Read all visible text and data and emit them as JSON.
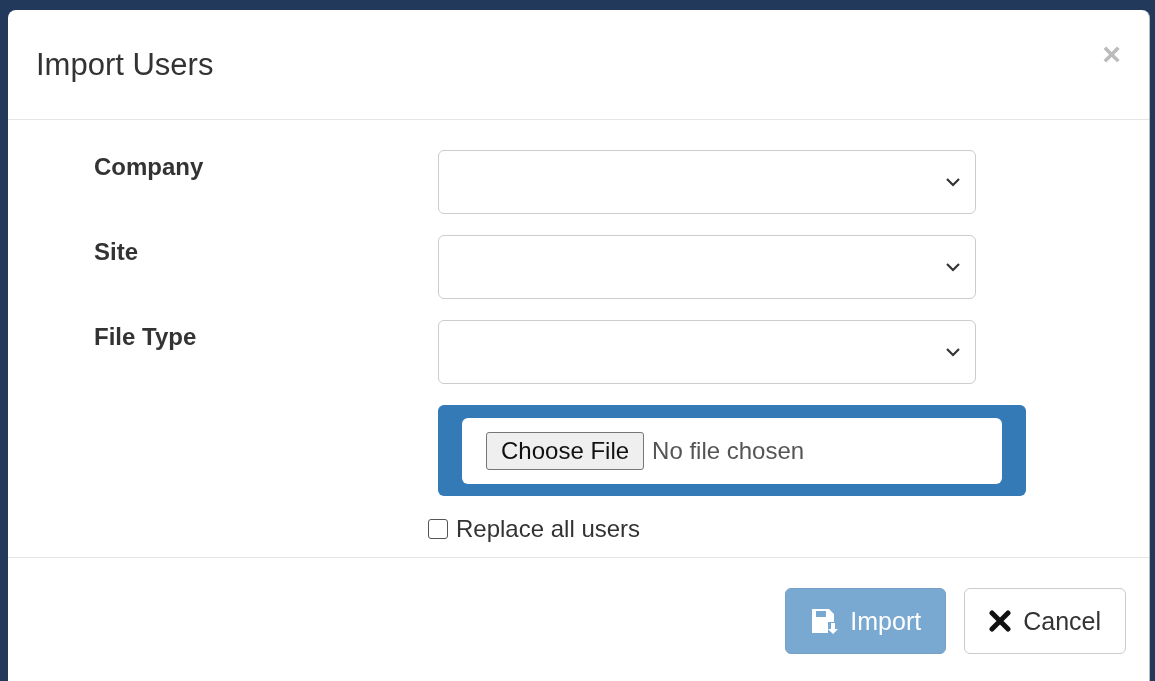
{
  "dialog": {
    "title": "Import Users",
    "close": "×"
  },
  "fields": [
    {
      "label": "Company",
      "kind": "select"
    },
    {
      "label": "Site",
      "kind": "select"
    },
    {
      "label": "File Type",
      "kind": "select"
    }
  ],
  "file_input": {
    "button": "Choose File",
    "status": "No file chosen",
    "focused": true
  },
  "replace_all": {
    "label": "Replace all users",
    "checked": false
  },
  "buttons": [
    {
      "label": "Import",
      "kind": "primary",
      "disabled": true
    },
    {
      "label": "Cancel",
      "kind": "cancel",
      "disabled": false
    }
  ]
}
